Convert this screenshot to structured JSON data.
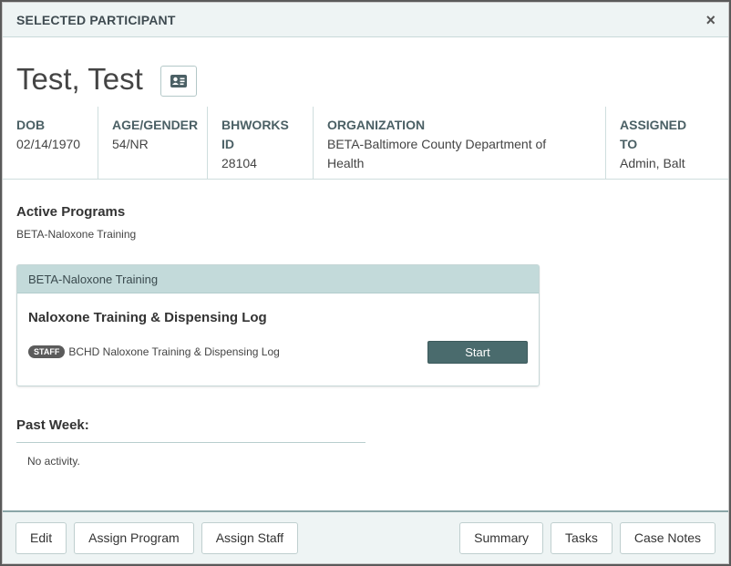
{
  "modal": {
    "title": "SELECTED PARTICIPANT",
    "close_glyph": "×"
  },
  "participant": {
    "name": "Test, Test",
    "card_icon": "id-card-icon"
  },
  "info": {
    "dob_label": "DOB",
    "dob_value": "02/14/1970",
    "age_label": "AGE/GENDER",
    "age_value": "54/NR",
    "id_label_1": "BHWORKS",
    "id_label_2": "ID",
    "id_value": "28104",
    "org_label": "ORGANIZATION",
    "org_value_1": "BETA-Baltimore County Department of",
    "org_value_2": "Health",
    "assigned_label_1": "ASSIGNED",
    "assigned_label_2": "TO",
    "assigned_value": "Admin, Balt"
  },
  "active_programs": {
    "title": "Active Programs",
    "items": [
      "BETA-Naloxone Training"
    ]
  },
  "program_panel": {
    "header": "BETA-Naloxone Training",
    "form_title": "Naloxone Training & Dispensing Log",
    "badge": "STAFF",
    "form_name": "BCHD Naloxone Training & Dispensing Log",
    "start_label": "Start"
  },
  "past_week": {
    "title": "Past Week:",
    "empty_text": "No activity."
  },
  "footer": {
    "left_buttons": [
      "Edit",
      "Assign Program",
      "Assign Staff"
    ],
    "right_buttons": [
      "Summary",
      "Tasks",
      "Case Notes"
    ]
  },
  "colors": {
    "header_bg": "#eef4f4",
    "panel_head_bg": "#c3dada",
    "start_button": "#4a6b6d"
  }
}
